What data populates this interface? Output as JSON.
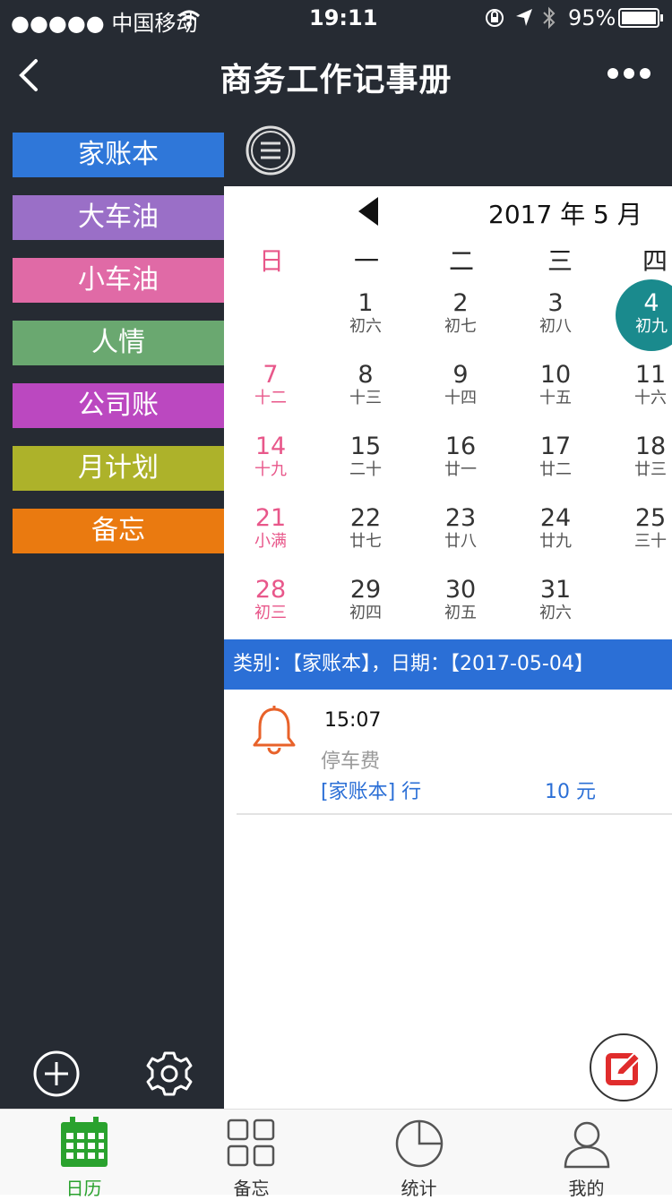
{
  "status": {
    "carrier": "●●●●● 中国移动",
    "time": "19:11",
    "battery": "95%"
  },
  "nav": {
    "title": "商务工作记事册"
  },
  "sidebar": {
    "categories": [
      {
        "label": "家账本",
        "color": "#2f77d9"
      },
      {
        "label": "大车油",
        "color": "#9a6fc7"
      },
      {
        "label": "小车油",
        "color": "#e06aa6"
      },
      {
        "label": "人情",
        "color": "#6aa870"
      },
      {
        "label": "公司账",
        "color": "#bb48c0"
      },
      {
        "label": "月计划",
        "color": "#adb22a"
      },
      {
        "label": "备忘",
        "color": "#ea7a10"
      }
    ]
  },
  "calendar": {
    "month_label": "2017 年 5 月",
    "weekdays": [
      "日",
      "一",
      "二",
      "三",
      "四"
    ],
    "days": [
      {
        "n": "1",
        "l": "初六"
      },
      {
        "n": "2",
        "l": "初七"
      },
      {
        "n": "3",
        "l": "初八"
      },
      {
        "n": "4",
        "l": "初九"
      },
      {
        "n": "7",
        "l": "十二"
      },
      {
        "n": "8",
        "l": "十三"
      },
      {
        "n": "9",
        "l": "十四"
      },
      {
        "n": "10",
        "l": "十五"
      },
      {
        "n": "11",
        "l": "十六"
      },
      {
        "n": "14",
        "l": "十九"
      },
      {
        "n": "15",
        "l": "二十"
      },
      {
        "n": "16",
        "l": "廿一"
      },
      {
        "n": "17",
        "l": "廿二"
      },
      {
        "n": "18",
        "l": "廿三"
      },
      {
        "n": "21",
        "l": "小满"
      },
      {
        "n": "22",
        "l": "廿七"
      },
      {
        "n": "23",
        "l": "廿八"
      },
      {
        "n": "24",
        "l": "廿九"
      },
      {
        "n": "25",
        "l": "三十"
      },
      {
        "n": "28",
        "l": "初三"
      },
      {
        "n": "29",
        "l": "初四"
      },
      {
        "n": "30",
        "l": "初五"
      },
      {
        "n": "31",
        "l": "初六"
      }
    ],
    "selected_day": "4"
  },
  "info_bar": {
    "text": "类别：【家账本】，日期：【2017-05-04】"
  },
  "entry": {
    "time": "15:07",
    "desc": "停车费",
    "category": "[家账本] 行",
    "amount": "10 元"
  },
  "tabs": [
    {
      "label": "日历",
      "active": true
    },
    {
      "label": "备忘",
      "active": false
    },
    {
      "label": "统计",
      "active": false
    },
    {
      "label": "我的",
      "active": false
    }
  ],
  "colors": {
    "dark": "#262b33",
    "accent_green": "#2aa22e",
    "info_blue": "#2b6fd6",
    "sunday_pink": "#e8578a",
    "selected_teal": "#1a8a8d"
  }
}
